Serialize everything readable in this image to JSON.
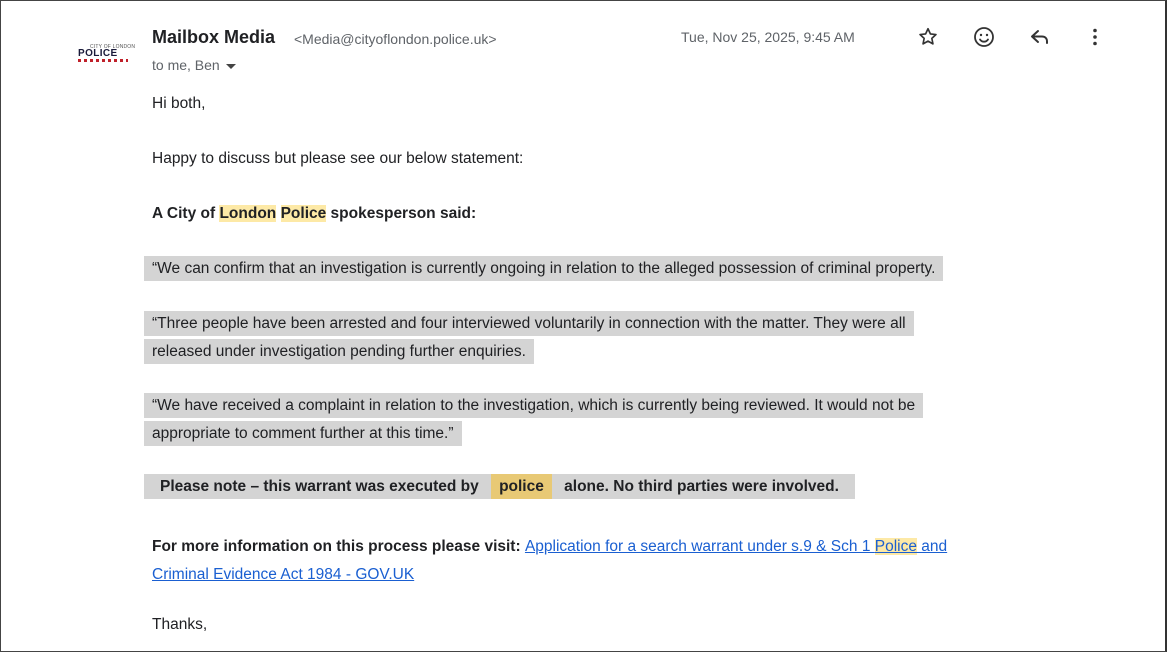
{
  "header": {
    "logo_text": "POLICE",
    "logo_small_text": "CITY OF LONDON",
    "sender_name": "Mailbox Media",
    "sender_email": "<Media@cityoflondon.police.uk>",
    "recipients": "to me, Ben",
    "date": "Tue, Nov 25, 2025, 9:45 AM",
    "icons": [
      "star-icon",
      "emoji-icon",
      "reply-icon",
      "more-vert-icon"
    ]
  },
  "body": {
    "greeting": "Hi both,",
    "intro": "Happy to discuss but please see our below statement:",
    "spokesperson": {
      "before": "A City of ",
      "hl1": "London",
      "space": " ",
      "hl2": "Police",
      "after": " spokesperson said:"
    },
    "quote1": "“We can confirm that an investigation is currently ongoing in relation to the alleged possession of criminal property.",
    "quote2_line1": "“Three people have been arrested and four interviewed voluntarily in connection with the matter. They were all",
    "quote2_line2": "released under investigation pending further enquiries.",
    "quote3_line1": "“We have received a complaint in relation to the investigation, which is currently being reviewed. It would not be",
    "quote3_line2": "appropriate to comment further at this time.”",
    "note": {
      "before": "Please note – this warrant was executed by ",
      "hl": "police",
      "after": " alone. No third parties were involved."
    },
    "more_info": {
      "label": "For more information on this process please visit: ",
      "link_part1": "Application for a search warrant under s.9 & Sch 1 ",
      "link_hl": "Police",
      "link_part2": " and",
      "link_line2": "Criminal Evidence Act 1984 - GOV.UK"
    },
    "signoff": "Thanks,"
  },
  "colors": {
    "highlight_yellow": "#fde9a6",
    "quote_grey": "#d4d4d4",
    "link": "#1a5fd1"
  }
}
